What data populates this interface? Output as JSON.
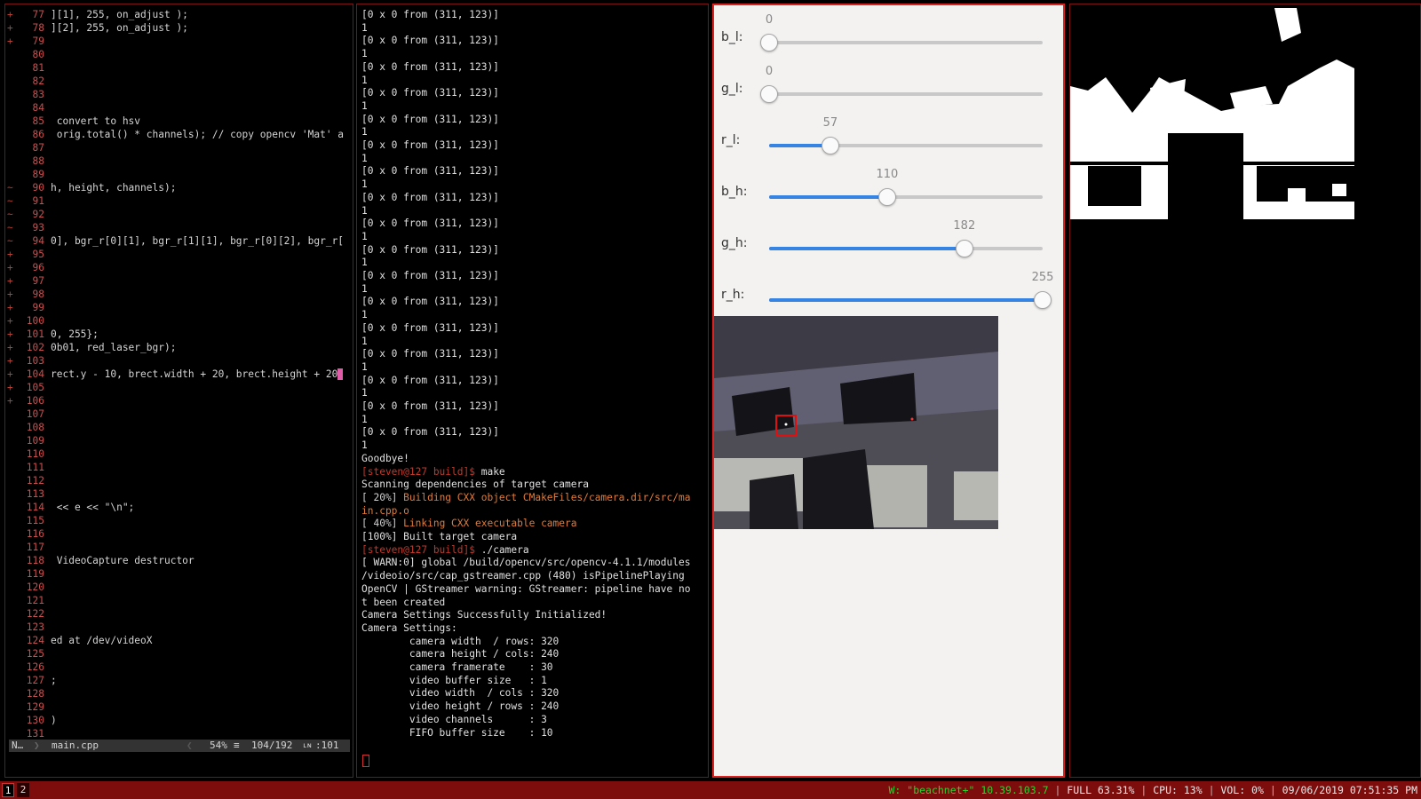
{
  "editor": {
    "lines": [
      {
        "mark": "+",
        "num": "77",
        "code": "][1], 255, on_adjust );"
      },
      {
        "mark": "+",
        "num": "78",
        "code": "][2], 255, on_adjust );"
      },
      {
        "mark": "+",
        "num": "79",
        "code": ""
      },
      {
        "mark": "",
        "num": "80",
        "code": ""
      },
      {
        "mark": "",
        "num": "81",
        "code": ""
      },
      {
        "mark": "",
        "num": "82",
        "code": ""
      },
      {
        "mark": "",
        "num": "83",
        "code": ""
      },
      {
        "mark": "",
        "num": "84",
        "code": ""
      },
      {
        "mark": "",
        "num": "85",
        "code": " convert to hsv"
      },
      {
        "mark": "",
        "num": "86",
        "code": " orig.total() * channels); // copy opencv 'Mat' a"
      },
      {
        "mark": "",
        "num": "87",
        "code": ""
      },
      {
        "mark": "",
        "num": "88",
        "code": ""
      },
      {
        "mark": "",
        "num": "89",
        "code": ""
      },
      {
        "mark": "~",
        "num": "90",
        "code": "h, height, channels);"
      },
      {
        "mark": "~",
        "num": "91",
        "code": ""
      },
      {
        "mark": "~",
        "num": "92",
        "code": ""
      },
      {
        "mark": "~",
        "num": "93",
        "code": ""
      },
      {
        "mark": "~",
        "num": "94",
        "code": "0], bgr_r[0][1], bgr_r[1][1], bgr_r[0][2], bgr_r["
      },
      {
        "mark": "+",
        "num": "95",
        "code": ""
      },
      {
        "mark": "+",
        "num": "96",
        "code": ""
      },
      {
        "mark": "+",
        "num": "97",
        "code": ""
      },
      {
        "mark": "+",
        "num": "98",
        "code": ""
      },
      {
        "mark": "+",
        "num": "99",
        "code": ""
      },
      {
        "mark": "+",
        "num": "100",
        "code": ""
      },
      {
        "mark": "+",
        "num": "101",
        "code": "0, 255};"
      },
      {
        "mark": "+",
        "num": "102",
        "code": "0b01, red_laser_bgr);"
      },
      {
        "mark": "+",
        "num": "103",
        "code": ""
      },
      {
        "mark": "+",
        "num": "104",
        "code": "rect.y - 10, brect.width + 20, brect.height + 20"
      },
      {
        "mark": "+",
        "num": "105",
        "code": ""
      },
      {
        "mark": "+",
        "num": "106",
        "code": ""
      },
      {
        "mark": "",
        "num": "107",
        "code": ""
      },
      {
        "mark": "",
        "num": "108",
        "code": ""
      },
      {
        "mark": "",
        "num": "109",
        "code": ""
      },
      {
        "mark": "",
        "num": "110",
        "code": ""
      },
      {
        "mark": "",
        "num": "111",
        "code": ""
      },
      {
        "mark": "",
        "num": "112",
        "code": ""
      },
      {
        "mark": "",
        "num": "113",
        "code": ""
      },
      {
        "mark": "",
        "num": "114",
        "code": " << e << \"\\n\";"
      },
      {
        "mark": "",
        "num": "115",
        "code": ""
      },
      {
        "mark": "",
        "num": "116",
        "code": ""
      },
      {
        "mark": "",
        "num": "117",
        "code": ""
      },
      {
        "mark": "",
        "num": "118",
        "code": " VideoCapture destructor"
      },
      {
        "mark": "",
        "num": "119",
        "code": ""
      },
      {
        "mark": "",
        "num": "120",
        "code": ""
      },
      {
        "mark": "",
        "num": "121",
        "code": ""
      },
      {
        "mark": "",
        "num": "122",
        "code": ""
      },
      {
        "mark": "",
        "num": "123",
        "code": ""
      },
      {
        "mark": "",
        "num": "124",
        "code": "ed at /dev/videoX"
      },
      {
        "mark": "",
        "num": "125",
        "code": ""
      },
      {
        "mark": "",
        "num": "126",
        "code": ""
      },
      {
        "mark": "",
        "num": "127",
        "code": ";"
      },
      {
        "mark": "",
        "num": "128",
        "code": ""
      },
      {
        "mark": "",
        "num": "129",
        "code": ""
      },
      {
        "mark": "",
        "num": "130",
        "code": ")"
      },
      {
        "mark": "",
        "num": "131",
        "code": ""
      }
    ],
    "status": {
      "mode": "N…",
      "file": "main.cpp",
      "percent": "54%",
      "position": "104/192",
      "col": ":101"
    }
  },
  "terminal": {
    "lines": [
      {
        "type": "out",
        "text": "[0 x 0 from (311, 123)]"
      },
      {
        "type": "out",
        "text": "1"
      },
      {
        "type": "out",
        "text": "[0 x 0 from (311, 123)]"
      },
      {
        "type": "out",
        "text": "1"
      },
      {
        "type": "out",
        "text": "[0 x 0 from (311, 123)]"
      },
      {
        "type": "out",
        "text": "1"
      },
      {
        "type": "out",
        "text": "[0 x 0 from (311, 123)]"
      },
      {
        "type": "out",
        "text": "1"
      },
      {
        "type": "out",
        "text": "[0 x 0 from (311, 123)]"
      },
      {
        "type": "out",
        "text": "1"
      },
      {
        "type": "out",
        "text": "[0 x 0 from (311, 123)]"
      },
      {
        "type": "out",
        "text": "1"
      },
      {
        "type": "out",
        "text": "[0 x 0 from (311, 123)]"
      },
      {
        "type": "out",
        "text": "1"
      },
      {
        "type": "out",
        "text": "[0 x 0 from (311, 123)]"
      },
      {
        "type": "out",
        "text": "1"
      },
      {
        "type": "out",
        "text": "[0 x 0 from (311, 123)]"
      },
      {
        "type": "out",
        "text": "1"
      },
      {
        "type": "out",
        "text": "[0 x 0 from (311, 123)]"
      },
      {
        "type": "out",
        "text": "1"
      },
      {
        "type": "out",
        "text": "[0 x 0 from (311, 123)]"
      },
      {
        "type": "out",
        "text": "1"
      },
      {
        "type": "out",
        "text": "[0 x 0 from (311, 123)]"
      },
      {
        "type": "out",
        "text": "1"
      },
      {
        "type": "out",
        "text": "[0 x 0 from (311, 123)]"
      },
      {
        "type": "out",
        "text": "1"
      },
      {
        "type": "out",
        "text": "[0 x 0 from (311, 123)]"
      },
      {
        "type": "out",
        "text": "1"
      },
      {
        "type": "out",
        "text": "[0 x 0 from (311, 123)]"
      },
      {
        "type": "out",
        "text": "1"
      },
      {
        "type": "out",
        "text": "[0 x 0 from (311, 123)]"
      },
      {
        "type": "out",
        "text": "1"
      },
      {
        "type": "out",
        "text": "[0 x 0 from (311, 123)]"
      },
      {
        "type": "out",
        "text": "1"
      },
      {
        "type": "out",
        "text": "Goodbye!"
      },
      {
        "type": "prompt",
        "text": "[steven@127 build]$ ",
        "cmd": "make"
      },
      {
        "type": "out",
        "text": "Scanning dependencies of target camera"
      },
      {
        "type": "build",
        "prefix": "[ 20%] ",
        "text": "Building CXX object CMakeFiles/camera.dir/src/ma"
      },
      {
        "type": "build",
        "prefix": "",
        "text": "in.cpp.o"
      },
      {
        "type": "build",
        "prefix": "[ 40%] ",
        "text": "Linking CXX executable camera"
      },
      {
        "type": "out",
        "text": "[100%] Built target camera"
      },
      {
        "type": "prompt",
        "text": "[steven@127 build]$ ",
        "cmd": "./camera"
      },
      {
        "type": "out",
        "text": "[ WARN:0] global /build/opencv/src/opencv-4.1.1/modules"
      },
      {
        "type": "out",
        "text": "/videoio/src/cap_gstreamer.cpp (480) isPipelinePlaying"
      },
      {
        "type": "out",
        "text": "OpenCV | GStreamer warning: GStreamer: pipeline have no"
      },
      {
        "type": "out",
        "text": "t been created"
      },
      {
        "type": "out",
        "text": "Camera Settings Successfully Initialized!"
      },
      {
        "type": "out",
        "text": "Camera Settings:"
      },
      {
        "type": "out",
        "text": "        camera width  / rows: 320"
      },
      {
        "type": "out",
        "text": "        camera height / cols: 240"
      },
      {
        "type": "out",
        "text": "        camera framerate    : 30"
      },
      {
        "type": "out",
        "text": "        video buffer size   : 1"
      },
      {
        "type": "out",
        "text": "        video width  / cols : 320"
      },
      {
        "type": "out",
        "text": "        video height / rows : 240"
      },
      {
        "type": "out",
        "text": "        video channels      : 3"
      },
      {
        "type": "out",
        "text": "        FIFO buffer size    : 10"
      }
    ]
  },
  "trackbars": [
    {
      "label": "b_l:",
      "value": 0,
      "max": 255
    },
    {
      "label": "g_l:",
      "value": 0,
      "max": 255
    },
    {
      "label": "r_l:",
      "value": 57,
      "max": 255
    },
    {
      "label": "b_h:",
      "value": 110,
      "max": 255
    },
    {
      "label": "g_h:",
      "value": 182,
      "max": 255
    },
    {
      "label": "r_h:",
      "value": 255,
      "max": 255
    }
  ],
  "colors": {
    "accent_red": "#d22222",
    "slider_blue": "#3584e4",
    "bar_bg": "#7d0d0d",
    "wifi_green": "#29d329"
  },
  "bar": {
    "workspaces": [
      "1",
      "2"
    ],
    "active_workspace": "1",
    "wifi_label": "W: \"beachnet+\" 10.39.103.7",
    "battery": "FULL 63.31%",
    "cpu": "CPU: 13%",
    "volume": "VOL: 0%",
    "datetime": "09/06/2019 07:51:35 PM"
  }
}
